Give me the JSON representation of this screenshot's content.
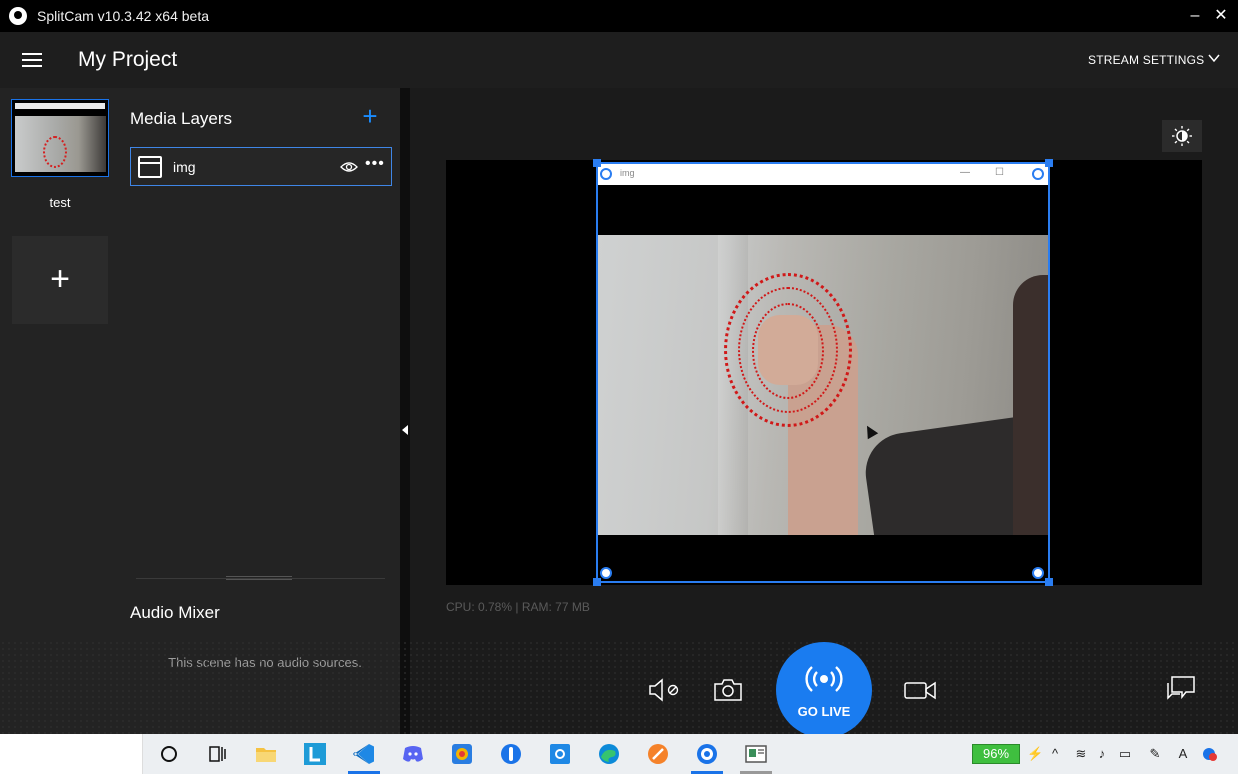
{
  "window": {
    "title": "SplitCam v10.3.42 x64 beta",
    "minimize_glyph": "–",
    "close_glyph": "✕"
  },
  "header": {
    "project_title": "My Project",
    "stream_settings_label": "STREAM SETTINGS"
  },
  "scenes": {
    "items": [
      {
        "label": "test"
      }
    ],
    "add_glyph": "+"
  },
  "media_layers": {
    "heading": "Media Layers",
    "add_glyph": "+",
    "layers": [
      {
        "name": "img"
      }
    ],
    "more_glyph": "•••"
  },
  "audio_mixer": {
    "heading": "Audio Mixer",
    "empty_message": "This scene has no audio sources."
  },
  "preview": {
    "source_window_title": "img",
    "stats": "CPU: 0.78% | RAM: 77 MB"
  },
  "controls": {
    "go_live_label": "GO LIVE"
  },
  "taskbar": {
    "battery": "96%",
    "icons": [
      "cortana-icon",
      "task-view-icon",
      "file-explorer-icon",
      "l-app-icon",
      "vscode-icon",
      "discord-icon",
      "store-icon",
      "app-icon",
      "settings-icon",
      "edge-icon",
      "pen-app-icon",
      "splitcam-icon",
      "presentation-icon"
    ]
  },
  "colors": {
    "accent": "#1a7cf0",
    "selection": "#2a7df1",
    "battery": "#3fbf3f"
  }
}
